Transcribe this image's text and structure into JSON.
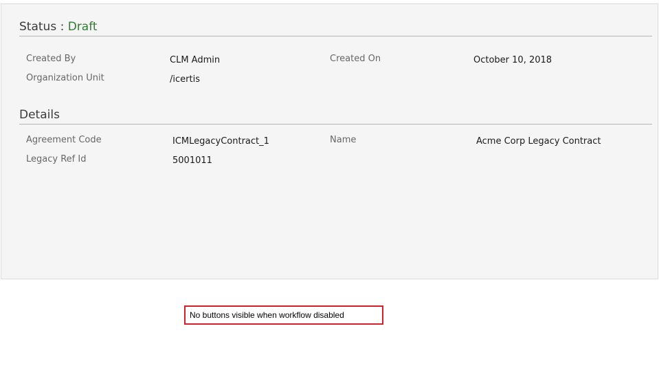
{
  "status": {
    "label": "Status :",
    "value": "Draft",
    "value_color": "#2e7d32"
  },
  "header_fields": {
    "created_by": {
      "label": "Created By",
      "value": "CLM Admin"
    },
    "created_on": {
      "label": "Created On",
      "value": "October 10, 2018"
    },
    "organization_unit": {
      "label": "Organization Unit",
      "value": "/icertis"
    }
  },
  "details": {
    "title": "Details",
    "agreement_code": {
      "label": "Agreement Code",
      "value": "ICMLegacyContract_1"
    },
    "name": {
      "label": "Name",
      "value": "Acme Corp Legacy Contract"
    },
    "legacy_ref_id": {
      "label": "Legacy Ref Id",
      "value": "5001011"
    }
  },
  "annotation": {
    "text": "No buttons visible when workflow disabled",
    "border_color": "#d32027"
  }
}
